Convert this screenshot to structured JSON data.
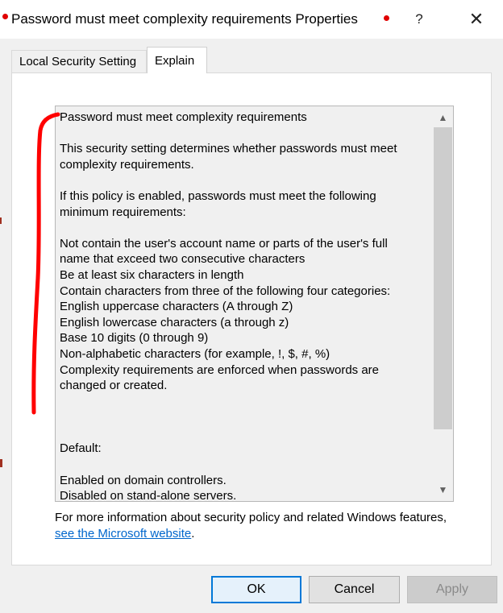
{
  "window": {
    "title": "Password must meet complexity requirements Properties",
    "help_label": "?",
    "close_label": "✕"
  },
  "tabs": [
    {
      "label": "Local Security Setting",
      "selected": false
    },
    {
      "label": "Explain",
      "selected": true
    }
  ],
  "explain": {
    "text": "Password must meet complexity requirements\n\nThis security setting determines whether passwords must meet\ncomplexity requirements.\n\nIf this policy is enabled, passwords must meet the following\nminimum requirements:\n\nNot contain the user's account name or parts of the user's full\nname that exceed two consecutive characters\nBe at least six characters in length\nContain characters from three of the following four categories:\nEnglish uppercase characters (A through Z)\nEnglish lowercase characters (a through z)\nBase 10 digits (0 through 9)\nNon-alphabetic characters (for example, !, $, #, %)\nComplexity requirements are enforced when passwords are\nchanged or created.\n\n\n\nDefault:\n\nEnabled on domain controllers.\nDisabled on stand-alone servers."
  },
  "info": {
    "prefix": "For more information about security policy and related Windows features, ",
    "link_text": "see the Microsoft website",
    "suffix": "."
  },
  "buttons": {
    "ok": "OK",
    "cancel": "Cancel",
    "apply": "Apply",
    "apply_enabled": false
  },
  "colors": {
    "annotation_red": "#ff0000",
    "link": "#0066cc",
    "focus_blue": "#0078d7"
  }
}
